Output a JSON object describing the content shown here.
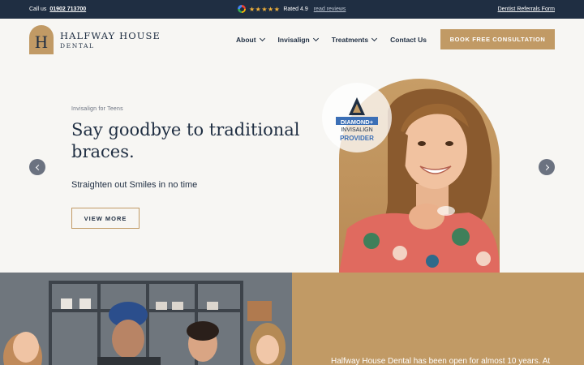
{
  "topbar": {
    "call_prefix": "Call us",
    "phone": "01902 713700",
    "rating_text": "Rated 4.9",
    "stars": "★★★★★",
    "read_reviews": "read reviews",
    "referral_link": "Dentist Referrals Form"
  },
  "brand": {
    "name": "HALFWAY HOUSE",
    "subtitle": "DENTAL",
    "mark": "H"
  },
  "nav": {
    "items": [
      {
        "label": "About",
        "has_dropdown": true
      },
      {
        "label": "Invisalign",
        "has_dropdown": true
      },
      {
        "label": "Treatments",
        "has_dropdown": true
      },
      {
        "label": "Contact Us",
        "has_dropdown": false
      }
    ],
    "cta": "BOOK FREE CONSULTATION"
  },
  "hero": {
    "kicker": "Invisalign for Teens",
    "headline": "Say goodbye to traditional braces.",
    "subheadline": "Straighten out Smiles in no time",
    "button": "VIEW MORE",
    "badge_line1": "DIAMOND+",
    "badge_line2": "INVISALIGN",
    "badge_line3": "PROVIDER"
  },
  "about": {
    "text_partial": "Halfway House Dental has been open for almost 10 years. At"
  },
  "colors": {
    "navy": "#1f2e42",
    "gold": "#c19a65",
    "background": "#f7f6f3",
    "star": "#f3b23a"
  }
}
